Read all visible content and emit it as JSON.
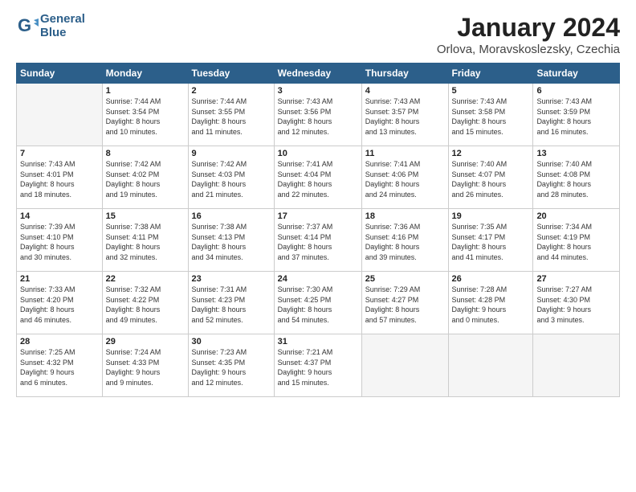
{
  "header": {
    "logo_line1": "General",
    "logo_line2": "Blue",
    "title": "January 2024",
    "subtitle": "Orlova, Moravskoslezsky, Czechia"
  },
  "days_of_week": [
    "Sunday",
    "Monday",
    "Tuesday",
    "Wednesday",
    "Thursday",
    "Friday",
    "Saturday"
  ],
  "weeks": [
    [
      {
        "num": "",
        "info": ""
      },
      {
        "num": "1",
        "info": "Sunrise: 7:44 AM\nSunset: 3:54 PM\nDaylight: 8 hours\nand 10 minutes."
      },
      {
        "num": "2",
        "info": "Sunrise: 7:44 AM\nSunset: 3:55 PM\nDaylight: 8 hours\nand 11 minutes."
      },
      {
        "num": "3",
        "info": "Sunrise: 7:43 AM\nSunset: 3:56 PM\nDaylight: 8 hours\nand 12 minutes."
      },
      {
        "num": "4",
        "info": "Sunrise: 7:43 AM\nSunset: 3:57 PM\nDaylight: 8 hours\nand 13 minutes."
      },
      {
        "num": "5",
        "info": "Sunrise: 7:43 AM\nSunset: 3:58 PM\nDaylight: 8 hours\nand 15 minutes."
      },
      {
        "num": "6",
        "info": "Sunrise: 7:43 AM\nSunset: 3:59 PM\nDaylight: 8 hours\nand 16 minutes."
      }
    ],
    [
      {
        "num": "7",
        "info": "Sunrise: 7:43 AM\nSunset: 4:01 PM\nDaylight: 8 hours\nand 18 minutes."
      },
      {
        "num": "8",
        "info": "Sunrise: 7:42 AM\nSunset: 4:02 PM\nDaylight: 8 hours\nand 19 minutes."
      },
      {
        "num": "9",
        "info": "Sunrise: 7:42 AM\nSunset: 4:03 PM\nDaylight: 8 hours\nand 21 minutes."
      },
      {
        "num": "10",
        "info": "Sunrise: 7:41 AM\nSunset: 4:04 PM\nDaylight: 8 hours\nand 22 minutes."
      },
      {
        "num": "11",
        "info": "Sunrise: 7:41 AM\nSunset: 4:06 PM\nDaylight: 8 hours\nand 24 minutes."
      },
      {
        "num": "12",
        "info": "Sunrise: 7:40 AM\nSunset: 4:07 PM\nDaylight: 8 hours\nand 26 minutes."
      },
      {
        "num": "13",
        "info": "Sunrise: 7:40 AM\nSunset: 4:08 PM\nDaylight: 8 hours\nand 28 minutes."
      }
    ],
    [
      {
        "num": "14",
        "info": "Sunrise: 7:39 AM\nSunset: 4:10 PM\nDaylight: 8 hours\nand 30 minutes."
      },
      {
        "num": "15",
        "info": "Sunrise: 7:38 AM\nSunset: 4:11 PM\nDaylight: 8 hours\nand 32 minutes."
      },
      {
        "num": "16",
        "info": "Sunrise: 7:38 AM\nSunset: 4:13 PM\nDaylight: 8 hours\nand 34 minutes."
      },
      {
        "num": "17",
        "info": "Sunrise: 7:37 AM\nSunset: 4:14 PM\nDaylight: 8 hours\nand 37 minutes."
      },
      {
        "num": "18",
        "info": "Sunrise: 7:36 AM\nSunset: 4:16 PM\nDaylight: 8 hours\nand 39 minutes."
      },
      {
        "num": "19",
        "info": "Sunrise: 7:35 AM\nSunset: 4:17 PM\nDaylight: 8 hours\nand 41 minutes."
      },
      {
        "num": "20",
        "info": "Sunrise: 7:34 AM\nSunset: 4:19 PM\nDaylight: 8 hours\nand 44 minutes."
      }
    ],
    [
      {
        "num": "21",
        "info": "Sunrise: 7:33 AM\nSunset: 4:20 PM\nDaylight: 8 hours\nand 46 minutes."
      },
      {
        "num": "22",
        "info": "Sunrise: 7:32 AM\nSunset: 4:22 PM\nDaylight: 8 hours\nand 49 minutes."
      },
      {
        "num": "23",
        "info": "Sunrise: 7:31 AM\nSunset: 4:23 PM\nDaylight: 8 hours\nand 52 minutes."
      },
      {
        "num": "24",
        "info": "Sunrise: 7:30 AM\nSunset: 4:25 PM\nDaylight: 8 hours\nand 54 minutes."
      },
      {
        "num": "25",
        "info": "Sunrise: 7:29 AM\nSunset: 4:27 PM\nDaylight: 8 hours\nand 57 minutes."
      },
      {
        "num": "26",
        "info": "Sunrise: 7:28 AM\nSunset: 4:28 PM\nDaylight: 9 hours\nand 0 minutes."
      },
      {
        "num": "27",
        "info": "Sunrise: 7:27 AM\nSunset: 4:30 PM\nDaylight: 9 hours\nand 3 minutes."
      }
    ],
    [
      {
        "num": "28",
        "info": "Sunrise: 7:25 AM\nSunset: 4:32 PM\nDaylight: 9 hours\nand 6 minutes."
      },
      {
        "num": "29",
        "info": "Sunrise: 7:24 AM\nSunset: 4:33 PM\nDaylight: 9 hours\nand 9 minutes."
      },
      {
        "num": "30",
        "info": "Sunrise: 7:23 AM\nSunset: 4:35 PM\nDaylight: 9 hours\nand 12 minutes."
      },
      {
        "num": "31",
        "info": "Sunrise: 7:21 AM\nSunset: 4:37 PM\nDaylight: 9 hours\nand 15 minutes."
      },
      {
        "num": "",
        "info": ""
      },
      {
        "num": "",
        "info": ""
      },
      {
        "num": "",
        "info": ""
      }
    ]
  ]
}
